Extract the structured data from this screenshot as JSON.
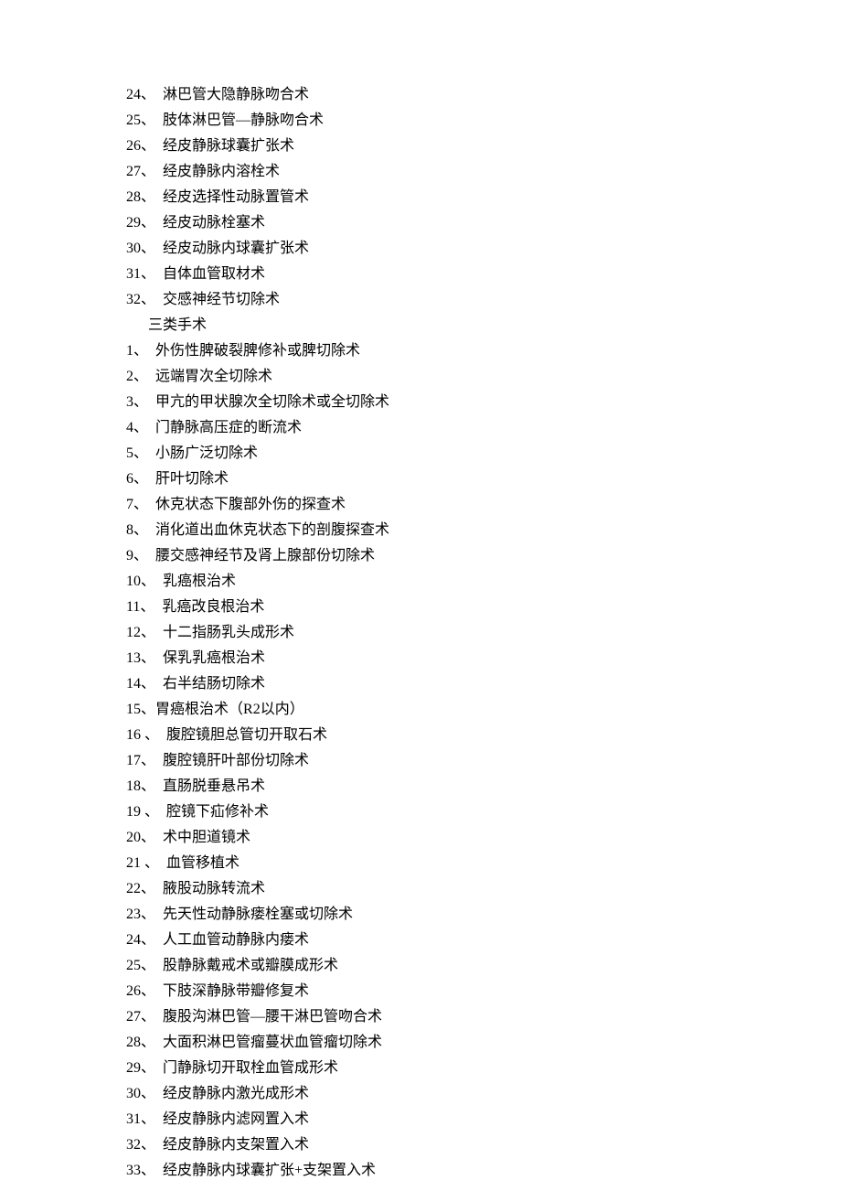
{
  "section1_items": [
    {
      "num": "24、",
      "text": "淋巴管大隐静脉吻合术"
    },
    {
      "num": "25、",
      "text": "肢体淋巴管—静脉吻合术"
    },
    {
      "num": "26、",
      "text": "经皮静脉球囊扩张术"
    },
    {
      "num": "27、",
      "text": "经皮静脉内溶栓术"
    },
    {
      "num": "28、",
      "text": "经皮选择性动脉置管术"
    },
    {
      "num": "29、",
      "text": "经皮动脉栓塞术"
    },
    {
      "num": "30、",
      "text": "经皮动脉内球囊扩张术"
    },
    {
      "num": "31、",
      "text": "自体血管取材术"
    },
    {
      "num": "32、",
      "text": "交感神经节切除术"
    }
  ],
  "heading": "三类手术",
  "section2_items": [
    {
      "num": "1、",
      "text": "外伤性脾破裂脾修补或脾切除术"
    },
    {
      "num": "2、",
      "text": "远端胃次全切除术"
    },
    {
      "num": "3、",
      "text": "甲亢的甲状腺次全切除术或全切除术"
    },
    {
      "num": "4、",
      "text": "门静脉高压症的断流术"
    },
    {
      "num": "5、",
      "text": "小肠广泛切除术"
    },
    {
      "num": "6、",
      "text": "肝叶切除术"
    },
    {
      "num": "7、",
      "text": "休克状态下腹部外伤的探查术"
    },
    {
      "num": "8、",
      "text": "消化道出血休克状态下的剖腹探查术"
    },
    {
      "num": "9、",
      "text": "腰交感神经节及肾上腺部份切除术"
    },
    {
      "num": "10、",
      "text": "乳癌根治术"
    },
    {
      "num": "11、",
      "text": "乳癌改良根治术"
    },
    {
      "num": "12、",
      "text": "十二指肠乳头成形术"
    },
    {
      "num": "13、",
      "text": "保乳乳癌根治术"
    },
    {
      "num": "14、",
      "text": "右半结肠切除术"
    },
    {
      "num": "15、",
      "text": "胃癌根治术（R2以内）",
      "tight": true
    },
    {
      "num": "16 、",
      "text": "腹腔镜胆总管切开取石术"
    },
    {
      "num": "17、",
      "text": "腹腔镜肝叶部份切除术"
    },
    {
      "num": "18、",
      "text": "直肠脱垂悬吊术"
    },
    {
      "num": "19 、",
      "text": "腔镜下疝修补术"
    },
    {
      "num": "20、",
      "text": "术中胆道镜术"
    },
    {
      "num": "21 、",
      "text": "血管移植术"
    },
    {
      "num": "22、",
      "text": "腋股动脉转流术"
    },
    {
      "num": "23、",
      "text": "先天性动静脉瘘栓塞或切除术"
    },
    {
      "num": "24、",
      "text": "人工血管动静脉内瘘术"
    },
    {
      "num": "25、",
      "text": "股静脉戴戒术或瓣膜成形术"
    },
    {
      "num": "26、",
      "text": "下肢深静脉带瓣修复术"
    },
    {
      "num": "27、",
      "text": "腹股沟淋巴管—腰干淋巴管吻合术"
    },
    {
      "num": "28、",
      "text": "大面积淋巴管瘤蔓状血管瘤切除术"
    },
    {
      "num": "29、",
      "text": "门静脉切开取栓血管成形术"
    },
    {
      "num": "30、",
      "text": "经皮静脉内激光成形术"
    },
    {
      "num": "31、",
      "text": "经皮静脉内滤网置入术"
    },
    {
      "num": "32、",
      "text": "经皮静脉内支架置入术"
    },
    {
      "num": "33、",
      "text": "经皮静脉内球囊扩张+支架置入术"
    }
  ]
}
